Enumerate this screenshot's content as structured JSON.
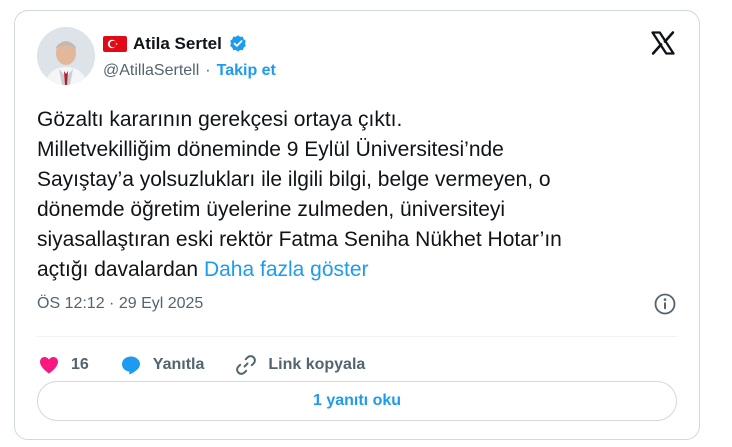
{
  "author": {
    "display_name": "Atila Sertel",
    "handle": "@AtillaSertell",
    "separator": "·",
    "follow_label": "Takip et"
  },
  "tweet": {
    "lines": [
      "Gözaltı kararının gerekçesi ortaya çıktı.",
      "Milletvekilliğim döneminde 9 Eylül Üniversitesi’nde",
      "Sayıştay’a yolsuzlukları ile ilgili bilgi, belge vermeyen, o",
      "dönemde öğretim üyelerine zulmeden, üniversiteyi",
      "siyasallaştıran eski rektör Fatma Seniha Nükhet Hotar’ın"
    ],
    "last_line": "açtığı davalardan",
    "show_more_label": "Daha fazla göster",
    "timestamp": "ÖS 12:12 · 29 Eyl 2025"
  },
  "actions": {
    "like_count": "16",
    "reply_label": "Yanıtla",
    "copy_link_label": "Link kopyala"
  },
  "replies_button_label": "1 yanıtı oku",
  "colors": {
    "accent": "#1d9bf0",
    "like": "#f91880",
    "secondary_text": "#536471",
    "border": "#cfd9de"
  },
  "icons": [
    "turkey-flag-icon",
    "verified-badge-icon",
    "x-logo-icon",
    "info-icon",
    "heart-icon",
    "reply-icon",
    "link-icon"
  ]
}
